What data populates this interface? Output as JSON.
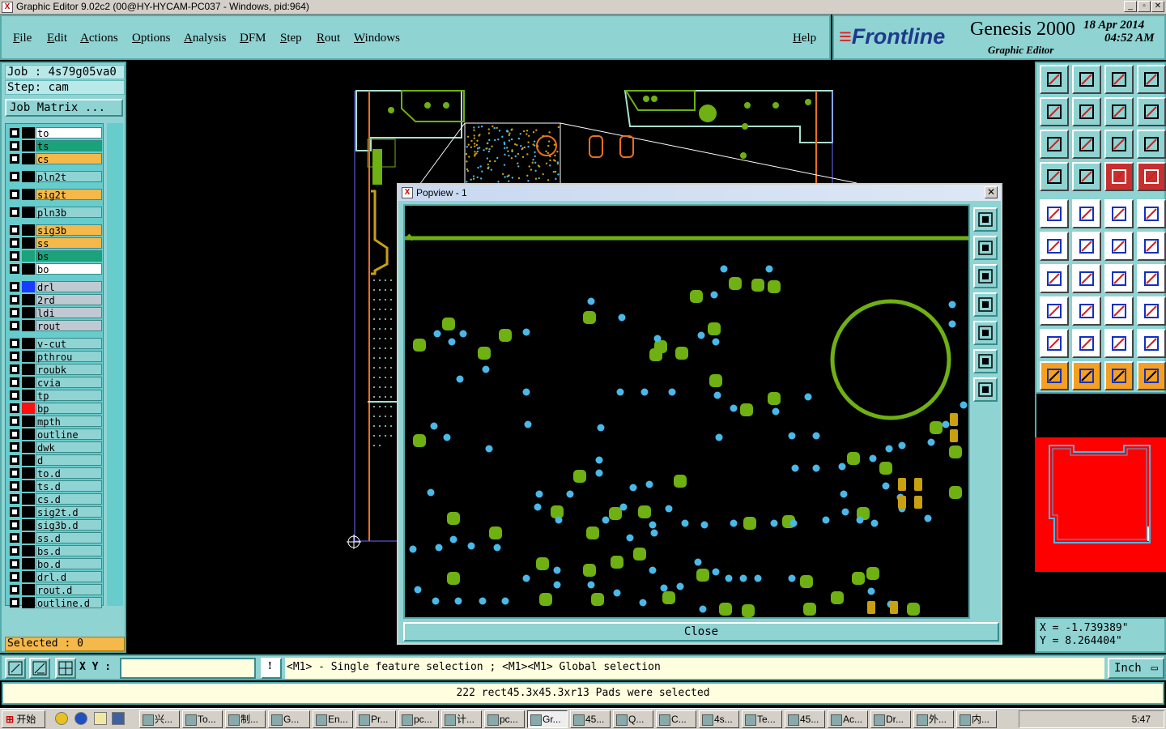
{
  "window": {
    "title": "Graphic Editor 9.02c2 (00@HY-HYCAM-PC037 - Windows, pid:964)"
  },
  "menu": {
    "file": "File",
    "edit": "Edit",
    "actions": "Actions",
    "options": "Options",
    "analysis": "Analysis",
    "dfm": "DFM",
    "step": "Step",
    "rout": "Rout",
    "windows": "Windows",
    "help": "Help"
  },
  "brand": {
    "logo_stripes": "≡",
    "logo": "Frontline",
    "product": "Genesis 2000",
    "subtitle": "Graphic Editor",
    "date": "18 Apr 2014",
    "time": "04:52 AM"
  },
  "job": {
    "job_line": "Job : 4s79g05va0",
    "step_line": "Step: cam",
    "matrix_button": "Job Matrix ..."
  },
  "layers": [
    {
      "name": "to",
      "color": "#ffffff",
      "swatch": "#000000"
    },
    {
      "name": "ts",
      "color": "#1aa37a",
      "swatch": "#000000"
    },
    {
      "name": "cs",
      "color": "#f5b84a",
      "swatch": "#000000"
    },
    {
      "name": "pln2t",
      "color": "#8fd3d3",
      "swatch": "#000000"
    },
    {
      "name": "sig2t",
      "color": "#f5b84a",
      "swatch": "#000000"
    },
    {
      "name": "pln3b",
      "color": "#8fd3d3",
      "swatch": "#000000"
    },
    {
      "name": "sig3b",
      "color": "#f5b84a",
      "swatch": "#000000"
    },
    {
      "name": "ss",
      "color": "#f5b84a",
      "swatch": "#000000"
    },
    {
      "name": "bs",
      "color": "#1aa37a",
      "swatch": "#1aa37a"
    },
    {
      "name": "bo",
      "color": "#ffffff",
      "swatch": "#000000"
    },
    {
      "name": "drl",
      "color": "#bfc9d2",
      "swatch": "#1a3cff"
    },
    {
      "name": "2rd",
      "color": "#bfc9d2",
      "swatch": "#000000"
    },
    {
      "name": "ldi",
      "color": "#bfc9d2",
      "swatch": "#000000"
    },
    {
      "name": "rout",
      "color": "#bfc9d2",
      "swatch": "#000000"
    },
    {
      "name": "v-cut",
      "color": "#8fd3d3",
      "swatch": "#000000"
    },
    {
      "name": "pthrou",
      "color": "#8fd3d3",
      "swatch": "#000000"
    },
    {
      "name": "roubk",
      "color": "#8fd3d3",
      "swatch": "#000000"
    },
    {
      "name": "cvia",
      "color": "#8fd3d3",
      "swatch": "#000000"
    },
    {
      "name": "tp",
      "color": "#8fd3d3",
      "swatch": "#000000"
    },
    {
      "name": "bp",
      "color": "#8fd3d3",
      "swatch": "#ff1010"
    },
    {
      "name": "mpth",
      "color": "#8fd3d3",
      "swatch": "#000000"
    },
    {
      "name": "outline",
      "color": "#8fd3d3",
      "swatch": "#000000"
    },
    {
      "name": "dwk",
      "color": "#8fd3d3",
      "swatch": "#000000"
    },
    {
      "name": "d",
      "color": "#8fd3d3",
      "swatch": "#000000"
    },
    {
      "name": "to.d",
      "color": "#8fd3d3",
      "swatch": "#000000"
    },
    {
      "name": "ts.d",
      "color": "#8fd3d3",
      "swatch": "#000000"
    },
    {
      "name": "cs.d",
      "color": "#8fd3d3",
      "swatch": "#000000"
    },
    {
      "name": "sig2t.d",
      "color": "#8fd3d3",
      "swatch": "#000000"
    },
    {
      "name": "sig3b.d",
      "color": "#8fd3d3",
      "swatch": "#000000"
    },
    {
      "name": "ss.d",
      "color": "#8fd3d3",
      "swatch": "#000000"
    },
    {
      "name": "bs.d",
      "color": "#8fd3d3",
      "swatch": "#000000"
    },
    {
      "name": "bo.d",
      "color": "#8fd3d3",
      "swatch": "#000000"
    },
    {
      "name": "drl.d",
      "color": "#8fd3d3",
      "swatch": "#000000"
    },
    {
      "name": "rout.d",
      "color": "#8fd3d3",
      "swatch": "#000000"
    },
    {
      "name": "outline.d",
      "color": "#8fd3d3",
      "swatch": "#000000"
    }
  ],
  "selected_label": "Selected : 0",
  "popview": {
    "title": "Popview - 1",
    "close_x": "✕",
    "close_button": "Close"
  },
  "coords": {
    "x_label": "X = -1.739389\"",
    "y_label": "Y = 8.264404\""
  },
  "status": {
    "xy_label": "X Y :",
    "xy_value": "",
    "warn": "!",
    "hint": "<M1> - Single feature selection ; <M1><M1> Global selection",
    "units": "Inch",
    "message": "222 rect45.3x45.3xr13 Pads were selected"
  },
  "taskbar": {
    "start": "开始",
    "tasks": [
      "兴...",
      "To...",
      "制...",
      "G...",
      "En...",
      "Pr...",
      "pc...",
      "计...",
      "pc...",
      "Gr...",
      "45...",
      "Q...",
      "C...",
      "4s...",
      "Te...",
      "45...",
      "Ac...",
      "Dr...",
      "外...",
      "内..."
    ],
    "clock": "5:47"
  },
  "colors": {
    "panel": "#8fd3d3",
    "pad_green": "#6fb012",
    "via_cyan": "#4ab8e8",
    "pad_yellow": "#c8a010",
    "outline": "#a8e0d0",
    "route": "#e87020",
    "minimap": "#ff0000"
  }
}
